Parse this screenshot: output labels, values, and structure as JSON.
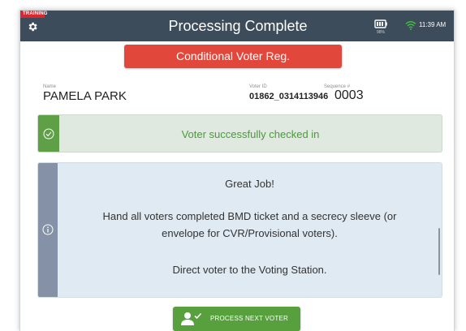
{
  "header": {
    "training_label": "TRAINING",
    "title": "Processing Complete",
    "battery_level": "98%",
    "time": "11:39 AM"
  },
  "status": {
    "label": "Conditional Voter Reg.",
    "color": "#e2473c"
  },
  "voter": {
    "name_label": "Name",
    "name": "PAMELA PARK",
    "id_label": "Voter ID",
    "id": "01862_0314113946",
    "sequence_label": "Sequence #",
    "sequence": "0003"
  },
  "success": {
    "text": "Voter successfully checked in",
    "icon": "check-circle-icon",
    "color": "#5fa046"
  },
  "message": {
    "title": "Great Job!",
    "line1": "Hand all voters completed BMD ticket and a secrecy sleeve (or",
    "line2": "envelope for CVR/Provisional voters).",
    "direction": "Direct voter to the Voting Station.",
    "icon": "info-circle-icon"
  },
  "actions": {
    "next_label": "PROCESS NEXT VOTER",
    "next_icon": "person-check-icon",
    "color": "#57a03d"
  },
  "icons": {
    "settings": "gear-icon",
    "battery": "battery-icon",
    "wifi": "wifi-icon"
  }
}
